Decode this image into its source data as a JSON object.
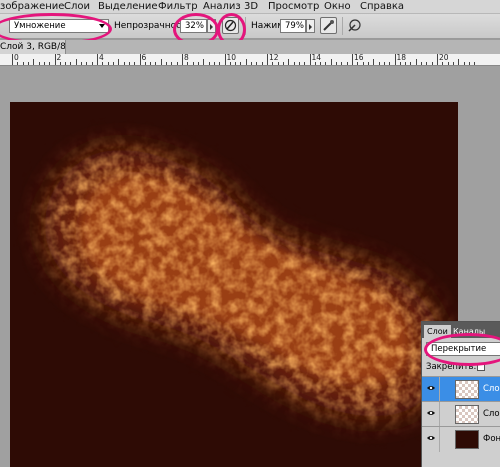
{
  "menu": [
    "зображение",
    "Слои",
    "Выделение",
    "Фильтр",
    "Анализ",
    "3D",
    "Просмотр",
    "Окно",
    "Справка"
  ],
  "options": {
    "mode_label_fragment": "",
    "blend_mode": "Умножение",
    "opacity_label": "Непрозрачность:",
    "opacity_value": "32%",
    "flow_label": "Нажим:",
    "flow_value": "79%"
  },
  "document_tab": "Слой 3, RGB/8) *",
  "ruler_numbers": [
    "0",
    "2",
    "4",
    "6",
    "8",
    "10",
    "12",
    "14",
    "16",
    "18",
    "20"
  ],
  "layers_panel": {
    "tabs": [
      "Слои",
      "Каналы"
    ],
    "blend_mode": "Перекрытие",
    "lock_label": "Закрепить:",
    "layers": [
      {
        "name": "Слой",
        "selected": true,
        "thumb": "transparent"
      },
      {
        "name": "Сло",
        "selected": false,
        "thumb": "transparent"
      },
      {
        "name": "Фон",
        "selected": false,
        "thumb": "dark"
      }
    ]
  },
  "colors": {
    "highlight": "#e4157c",
    "canvas_background": "#2e0b05",
    "texture_orange": "#e8752c",
    "selected_layer": "#3b8ee6"
  }
}
